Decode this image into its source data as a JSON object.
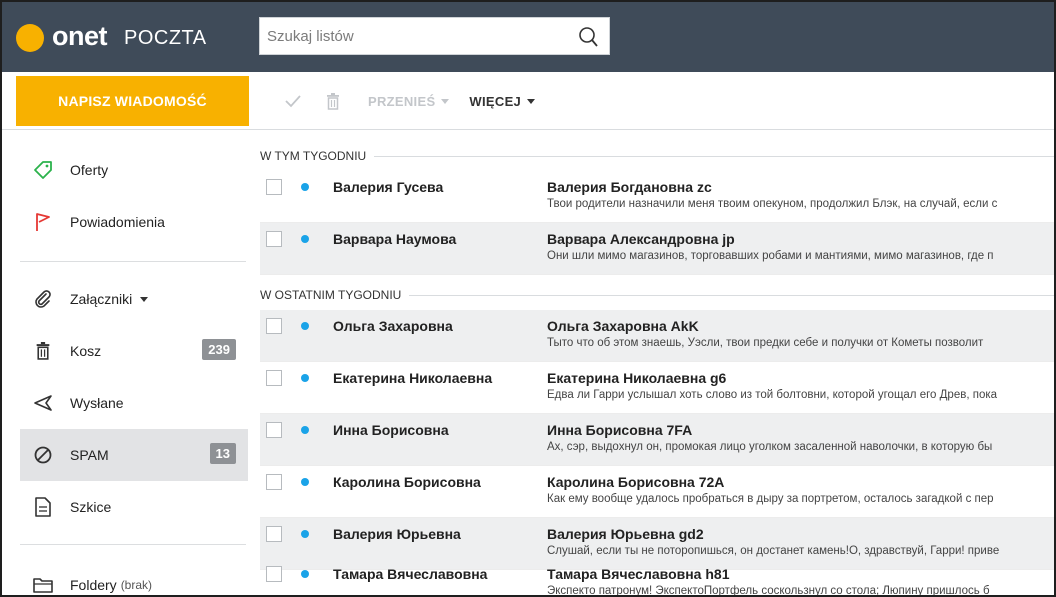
{
  "header": {
    "logo_onet": "onet",
    "logo_poczta": "POCZTA",
    "search_placeholder": "Szukaj listów"
  },
  "toolbar": {
    "compose_label": "NAPISZ WIADOMOŚĆ",
    "move_label": "PRZENIEŚ",
    "more_label": "WIĘCEJ"
  },
  "sidebar": {
    "items": [
      {
        "label": "Oferty",
        "icon": "tag-icon"
      },
      {
        "label": "Powiadomienia",
        "icon": "flag-icon"
      },
      {
        "label": "Załączniki",
        "icon": "paperclip-icon"
      },
      {
        "label": "Kosz",
        "icon": "trash-icon",
        "badge": "239"
      },
      {
        "label": "Wysłane",
        "icon": "send-icon"
      },
      {
        "label": "SPAM",
        "icon": "blocked-icon",
        "badge": "13",
        "active": true
      },
      {
        "label": "Szkice",
        "icon": "draft-icon"
      },
      {
        "label": "Foldery",
        "icon": "folder-icon",
        "suffix": "(brak)"
      }
    ]
  },
  "sections": [
    {
      "title": "W TYM TYGODNIU"
    },
    {
      "title": "W OSTATNIM TYGODNIU"
    }
  ],
  "emails": [
    {
      "sender": "Валерия Гусева",
      "subject": "Валерия Богдановна zc",
      "preview": "Твои родители назначили меня твоим опекуном, продолжил Блэк, на случай, если с"
    },
    {
      "sender": "Варвара Наумова",
      "subject": "Варвара Александровна jp",
      "preview": "Они шли мимо магазинов, торговавших робами и мантиями, мимо магазинов, где п"
    },
    {
      "sender": "Ольга Захаровна",
      "subject": "Ольга Захаровна AkK",
      "preview": "Тыто что об этом знаешь, Уэсли, твои предки себе и получки от Кометы позволит"
    },
    {
      "sender": "Екатерина Николаевна",
      "subject": "Екатерина Николаевна g6",
      "preview": "Едва ли Гарри услышал хоть слово из той болтовни, которой угощал его Древ, пока"
    },
    {
      "sender": "Инна Борисовна",
      "subject": "Инна Борисовна 7FA",
      "preview": "Ах, сэр, выдохнул он, промокая лицо уголком засаленной наволочки, в которую бы"
    },
    {
      "sender": "Каролина Борисовна",
      "subject": "Каролина Борисовна 72A",
      "preview": "Как ему вообще удалось пробраться в дыру за портретом, осталось загадкой с пер"
    },
    {
      "sender": "Валерия Юрьевна",
      "subject": "Валерия Юрьевна gd2",
      "preview": "Слушай, если ты не поторопишься, он достанет камень!О, здравствуй, Гарри! приве"
    },
    {
      "sender": "Тамара Вячеславовна",
      "subject": "Тамара Вячеславовна h81",
      "preview": "Экспекто патронум! ЭкспектоПортфель соскользнул со стола; Люпину пришлось б"
    }
  ],
  "colors": {
    "topbar": "#3f4b59",
    "accent": "#f8b100",
    "unread_dot": "#1aa3e8",
    "badge": "#8e9195"
  }
}
